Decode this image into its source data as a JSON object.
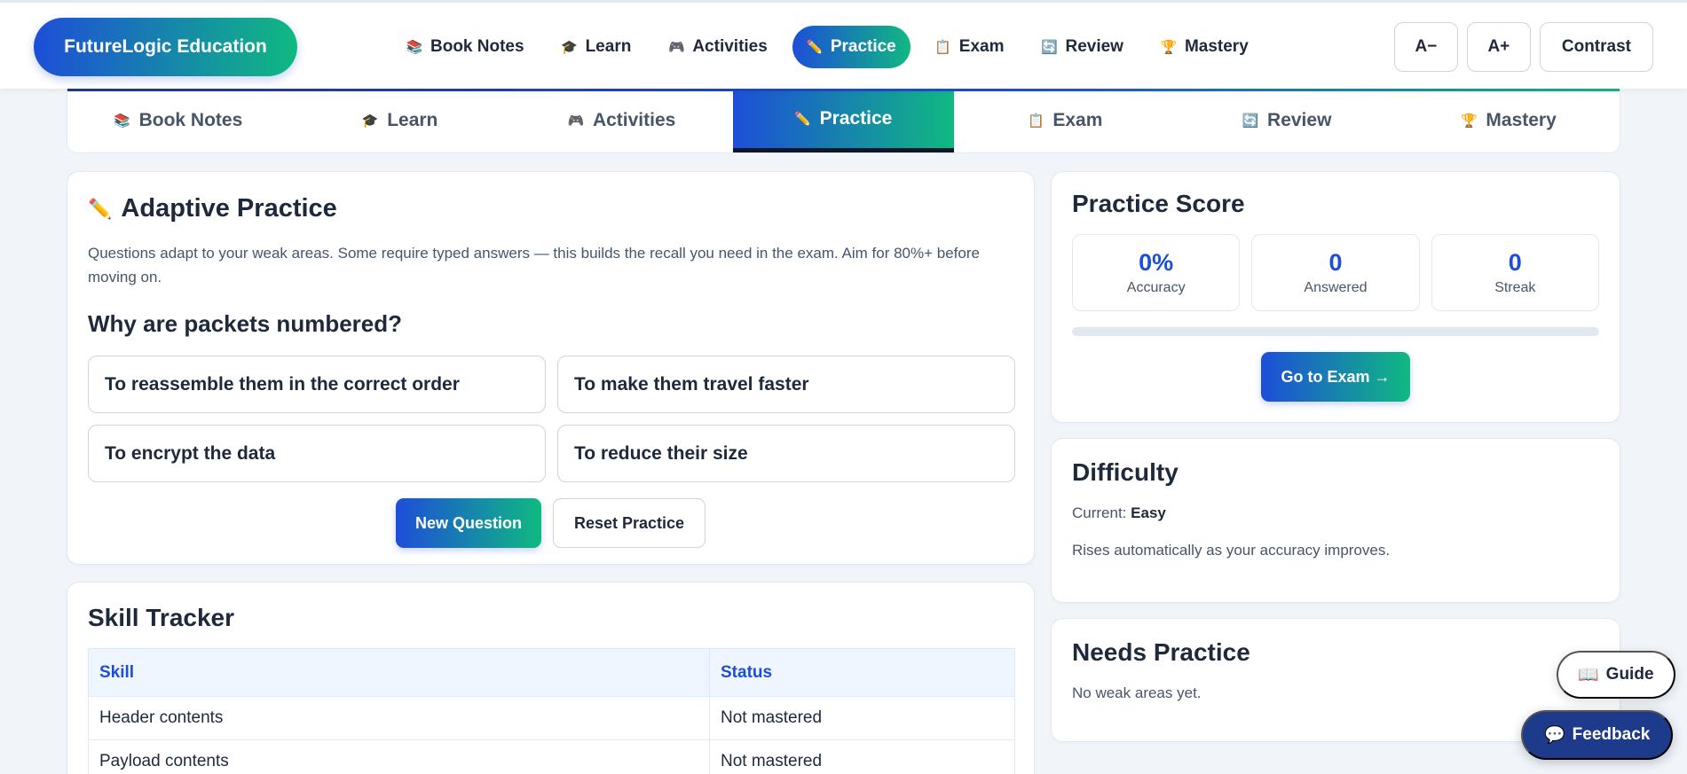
{
  "brand": "FutureLogic Education",
  "colors": {
    "accent_start": "#1d4ed8",
    "accent_end": "#10b981",
    "dark": "#1e3a8a"
  },
  "topnav": [
    {
      "icon": "📚",
      "icon_name": "books-icon",
      "label": "Book Notes"
    },
    {
      "icon": "🎓",
      "icon_name": "graduation-cap-icon",
      "label": "Learn"
    },
    {
      "icon": "🎮",
      "icon_name": "game-controller-icon",
      "label": "Activities"
    },
    {
      "icon": "✏️",
      "icon_name": "pencil-icon",
      "label": "Practice",
      "active": true
    },
    {
      "icon": "📋",
      "icon_name": "clipboard-icon",
      "label": "Exam"
    },
    {
      "icon": "🔄",
      "icon_name": "refresh-icon",
      "label": "Review"
    },
    {
      "icon": "🏆",
      "icon_name": "trophy-icon",
      "label": "Mastery"
    }
  ],
  "accessibility": {
    "decrease": "A−",
    "increase": "A+",
    "contrast": "Contrast"
  },
  "tabs": [
    {
      "icon": "📚",
      "icon_name": "books-icon",
      "label": "Book Notes"
    },
    {
      "icon": "🎓",
      "icon_name": "graduation-cap-icon",
      "label": "Learn"
    },
    {
      "icon": "🎮",
      "icon_name": "game-controller-icon",
      "label": "Activities"
    },
    {
      "icon": "✏️",
      "icon_name": "pencil-icon",
      "label": "Practice",
      "active": true
    },
    {
      "icon": "📋",
      "icon_name": "clipboard-icon",
      "label": "Exam"
    },
    {
      "icon": "🔄",
      "icon_name": "refresh-icon",
      "label": "Review"
    },
    {
      "icon": "🏆",
      "icon_name": "trophy-icon",
      "label": "Mastery"
    }
  ],
  "practice": {
    "icon": "✏️",
    "title": "Adaptive Practice",
    "intro": "Questions adapt to your weak areas. Some require typed answers — this builds the recall you need in the exam. Aim for 80%+ before moving on.",
    "question": "Why are packets numbered?",
    "answers": [
      "To reassemble them in the correct order",
      "To make them travel faster",
      "To encrypt the data",
      "To reduce their size"
    ],
    "new_question": "New Question",
    "reset": "Reset Practice"
  },
  "skill_tracker": {
    "title": "Skill Tracker",
    "headers": [
      "Skill",
      "Status"
    ],
    "rows": [
      [
        "Header contents",
        "Not mastered"
      ],
      [
        "Payload contents",
        "Not mastered"
      ]
    ]
  },
  "score": {
    "title": "Practice Score",
    "stats": [
      {
        "value": "0%",
        "label": "Accuracy"
      },
      {
        "value": "0",
        "label": "Answered"
      },
      {
        "value": "0",
        "label": "Streak"
      }
    ],
    "progress_percent": 0,
    "exam_button": "Go to Exam →"
  },
  "difficulty": {
    "title": "Difficulty",
    "current_label": "Current:",
    "current_value": "Easy",
    "note": "Rises automatically as your accuracy improves."
  },
  "needs_practice": {
    "title": "Needs Practice",
    "empty": "No weak areas yet."
  },
  "floating": {
    "guide_icon": "📖",
    "guide": "Guide",
    "feedback_icon": "💬",
    "feedback": "Feedback"
  }
}
